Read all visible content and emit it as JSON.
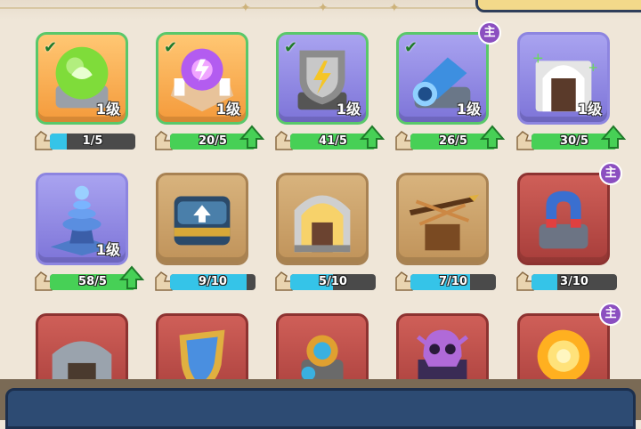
{
  "topbar": {},
  "items": [
    {
      "id": "green-orb",
      "level": "1级",
      "progress": "1/5",
      "completed": true,
      "primary": false,
      "bg": "orange",
      "fill_fraction": 0.2,
      "upgrade": false
    },
    {
      "id": "purple-crystal",
      "level": "1级",
      "progress": "20/5",
      "completed": true,
      "primary": false,
      "bg": "orange",
      "fill_fraction": 1,
      "upgrade": true
    },
    {
      "id": "lightning-shield",
      "level": "1级",
      "progress": "41/5",
      "completed": true,
      "primary": false,
      "bg": "purple",
      "fill_fraction": 1,
      "upgrade": true
    },
    {
      "id": "blue-cannon",
      "level": "1级",
      "progress": "26/5",
      "completed": true,
      "primary": true,
      "primary_label": "主",
      "bg": "purple",
      "fill_fraction": 1,
      "upgrade": true
    },
    {
      "id": "healing-gate",
      "level": "1级",
      "progress": "30/5",
      "completed": false,
      "primary": false,
      "bg": "purple",
      "fill_fraction": 1,
      "upgrade": true
    },
    {
      "id": "tesla-tower",
      "level": "1级",
      "progress": "58/5",
      "completed": false,
      "primary": false,
      "bg": "purple",
      "fill_fraction": 1,
      "upgrade": true
    },
    {
      "id": "supply-crate",
      "level": "",
      "progress": "9/10",
      "completed": false,
      "primary": false,
      "bg": "tan",
      "fill_fraction": 0.9,
      "upgrade": false
    },
    {
      "id": "golden-gate",
      "level": "",
      "progress": "5/10",
      "completed": false,
      "primary": false,
      "bg": "tan",
      "fill_fraction": 0.5,
      "upgrade": false
    },
    {
      "id": "ballista",
      "level": "",
      "progress": "7/10",
      "completed": false,
      "primary": false,
      "bg": "tan",
      "fill_fraction": 0.7,
      "upgrade": false
    },
    {
      "id": "magnet",
      "level": "",
      "progress": "3/10",
      "completed": false,
      "primary": true,
      "primary_label": "主",
      "bg": "red",
      "fill_fraction": 0.3,
      "upgrade": false
    },
    {
      "id": "stone-gate",
      "bg": "red",
      "primary": false
    },
    {
      "id": "blue-shield",
      "bg": "red",
      "primary": false
    },
    {
      "id": "orb-tower",
      "bg": "red",
      "primary": false
    },
    {
      "id": "skull-totem",
      "bg": "red",
      "primary": false
    },
    {
      "id": "fire-orb",
      "bg": "red",
      "primary": true,
      "primary_label": "主"
    }
  ],
  "colors": {
    "complete_border": "#59c86a",
    "progress_blue": "#35c4e8",
    "progress_green": "#47d056",
    "badge_purple": "#8b4fc0"
  }
}
